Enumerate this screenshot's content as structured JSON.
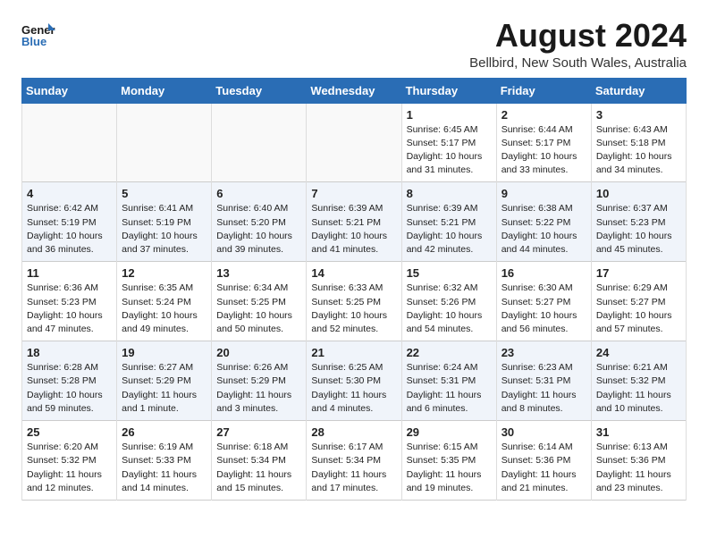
{
  "header": {
    "logo_line1": "General",
    "logo_line2": "Blue",
    "month_year": "August 2024",
    "location": "Bellbird, New South Wales, Australia"
  },
  "weekdays": [
    "Sunday",
    "Monday",
    "Tuesday",
    "Wednesday",
    "Thursday",
    "Friday",
    "Saturday"
  ],
  "weeks": [
    [
      {
        "day": "",
        "info": ""
      },
      {
        "day": "",
        "info": ""
      },
      {
        "day": "",
        "info": ""
      },
      {
        "day": "",
        "info": ""
      },
      {
        "day": "1",
        "info": "Sunrise: 6:45 AM\nSunset: 5:17 PM\nDaylight: 10 hours\nand 31 minutes."
      },
      {
        "day": "2",
        "info": "Sunrise: 6:44 AM\nSunset: 5:17 PM\nDaylight: 10 hours\nand 33 minutes."
      },
      {
        "day": "3",
        "info": "Sunrise: 6:43 AM\nSunset: 5:18 PM\nDaylight: 10 hours\nand 34 minutes."
      }
    ],
    [
      {
        "day": "4",
        "info": "Sunrise: 6:42 AM\nSunset: 5:19 PM\nDaylight: 10 hours\nand 36 minutes."
      },
      {
        "day": "5",
        "info": "Sunrise: 6:41 AM\nSunset: 5:19 PM\nDaylight: 10 hours\nand 37 minutes."
      },
      {
        "day": "6",
        "info": "Sunrise: 6:40 AM\nSunset: 5:20 PM\nDaylight: 10 hours\nand 39 minutes."
      },
      {
        "day": "7",
        "info": "Sunrise: 6:39 AM\nSunset: 5:21 PM\nDaylight: 10 hours\nand 41 minutes."
      },
      {
        "day": "8",
        "info": "Sunrise: 6:39 AM\nSunset: 5:21 PM\nDaylight: 10 hours\nand 42 minutes."
      },
      {
        "day": "9",
        "info": "Sunrise: 6:38 AM\nSunset: 5:22 PM\nDaylight: 10 hours\nand 44 minutes."
      },
      {
        "day": "10",
        "info": "Sunrise: 6:37 AM\nSunset: 5:23 PM\nDaylight: 10 hours\nand 45 minutes."
      }
    ],
    [
      {
        "day": "11",
        "info": "Sunrise: 6:36 AM\nSunset: 5:23 PM\nDaylight: 10 hours\nand 47 minutes."
      },
      {
        "day": "12",
        "info": "Sunrise: 6:35 AM\nSunset: 5:24 PM\nDaylight: 10 hours\nand 49 minutes."
      },
      {
        "day": "13",
        "info": "Sunrise: 6:34 AM\nSunset: 5:25 PM\nDaylight: 10 hours\nand 50 minutes."
      },
      {
        "day": "14",
        "info": "Sunrise: 6:33 AM\nSunset: 5:25 PM\nDaylight: 10 hours\nand 52 minutes."
      },
      {
        "day": "15",
        "info": "Sunrise: 6:32 AM\nSunset: 5:26 PM\nDaylight: 10 hours\nand 54 minutes."
      },
      {
        "day": "16",
        "info": "Sunrise: 6:30 AM\nSunset: 5:27 PM\nDaylight: 10 hours\nand 56 minutes."
      },
      {
        "day": "17",
        "info": "Sunrise: 6:29 AM\nSunset: 5:27 PM\nDaylight: 10 hours\nand 57 minutes."
      }
    ],
    [
      {
        "day": "18",
        "info": "Sunrise: 6:28 AM\nSunset: 5:28 PM\nDaylight: 10 hours\nand 59 minutes."
      },
      {
        "day": "19",
        "info": "Sunrise: 6:27 AM\nSunset: 5:29 PM\nDaylight: 11 hours\nand 1 minute."
      },
      {
        "day": "20",
        "info": "Sunrise: 6:26 AM\nSunset: 5:29 PM\nDaylight: 11 hours\nand 3 minutes."
      },
      {
        "day": "21",
        "info": "Sunrise: 6:25 AM\nSunset: 5:30 PM\nDaylight: 11 hours\nand 4 minutes."
      },
      {
        "day": "22",
        "info": "Sunrise: 6:24 AM\nSunset: 5:31 PM\nDaylight: 11 hours\nand 6 minutes."
      },
      {
        "day": "23",
        "info": "Sunrise: 6:23 AM\nSunset: 5:31 PM\nDaylight: 11 hours\nand 8 minutes."
      },
      {
        "day": "24",
        "info": "Sunrise: 6:21 AM\nSunset: 5:32 PM\nDaylight: 11 hours\nand 10 minutes."
      }
    ],
    [
      {
        "day": "25",
        "info": "Sunrise: 6:20 AM\nSunset: 5:32 PM\nDaylight: 11 hours\nand 12 minutes."
      },
      {
        "day": "26",
        "info": "Sunrise: 6:19 AM\nSunset: 5:33 PM\nDaylight: 11 hours\nand 14 minutes."
      },
      {
        "day": "27",
        "info": "Sunrise: 6:18 AM\nSunset: 5:34 PM\nDaylight: 11 hours\nand 15 minutes."
      },
      {
        "day": "28",
        "info": "Sunrise: 6:17 AM\nSunset: 5:34 PM\nDaylight: 11 hours\nand 17 minutes."
      },
      {
        "day": "29",
        "info": "Sunrise: 6:15 AM\nSunset: 5:35 PM\nDaylight: 11 hours\nand 19 minutes."
      },
      {
        "day": "30",
        "info": "Sunrise: 6:14 AM\nSunset: 5:36 PM\nDaylight: 11 hours\nand 21 minutes."
      },
      {
        "day": "31",
        "info": "Sunrise: 6:13 AM\nSunset: 5:36 PM\nDaylight: 11 hours\nand 23 minutes."
      }
    ]
  ]
}
